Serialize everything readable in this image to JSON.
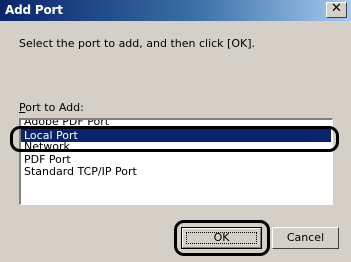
{
  "window": {
    "title": "Add Port",
    "close_glyph": "✕"
  },
  "instruction": "Select the port to add, and then click [OK].",
  "list": {
    "label_mnemonic": "P",
    "label_rest": "ort to Add:",
    "items": [
      {
        "label": "Adobe PDF Port",
        "selected": false
      },
      {
        "label": "Local Port",
        "selected": true
      },
      {
        "label": "Network",
        "selected": false
      },
      {
        "label": "PDF Port",
        "selected": false
      },
      {
        "label": "Standard TCP/IP Port",
        "selected": false
      }
    ]
  },
  "buttons": {
    "ok": "OK",
    "cancel": "Cancel"
  },
  "colors": {
    "title_bar_start": "#0a246a",
    "title_bar_end": "#a6caf0",
    "selection": "#0a246a",
    "dialog_face": "#d4d0c8"
  },
  "icons": [
    "close-icon"
  ]
}
